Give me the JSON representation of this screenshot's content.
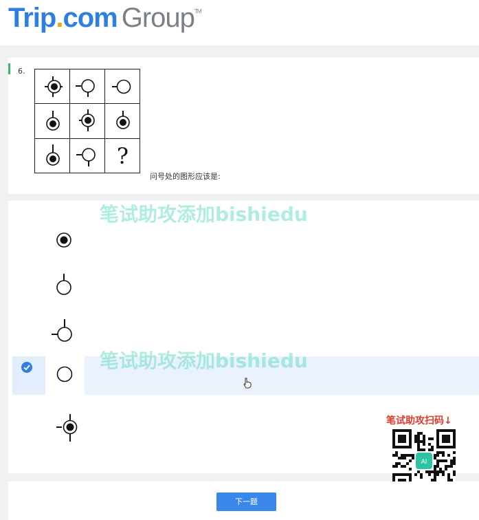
{
  "header": {
    "logo_trip": "Trip",
    "logo_dot": ".",
    "logo_com": "com",
    "logo_group": "Group",
    "logo_tm": "TM"
  },
  "question": {
    "number": "6.",
    "grid_question_mark": "?",
    "prompt": "问号处的图形应该是:"
  },
  "options": [
    {
      "icon": "filled-circle-icon",
      "selected": false
    },
    {
      "icon": "circle-stem-top-icon",
      "selected": false
    },
    {
      "icon": "circle-stem-top-left-icon",
      "selected": true
    },
    {
      "icon": "plain-circle-icon",
      "selected": false
    },
    {
      "icon": "filled-circle-cross-icon",
      "selected": false
    }
  ],
  "watermark": {
    "text": "笔试助攻添加bishiedu"
  },
  "qr": {
    "label": "笔试助攻扫码↓",
    "center_text": "AI"
  },
  "footer": {
    "next_button": "下一题"
  },
  "colors": {
    "brand_blue": "#2f7ee4",
    "brand_orange": "#f4a21a",
    "selected_bg": "#e9f2fd",
    "watermark": "#6edcc8",
    "qr_label": "#e23a2b"
  }
}
